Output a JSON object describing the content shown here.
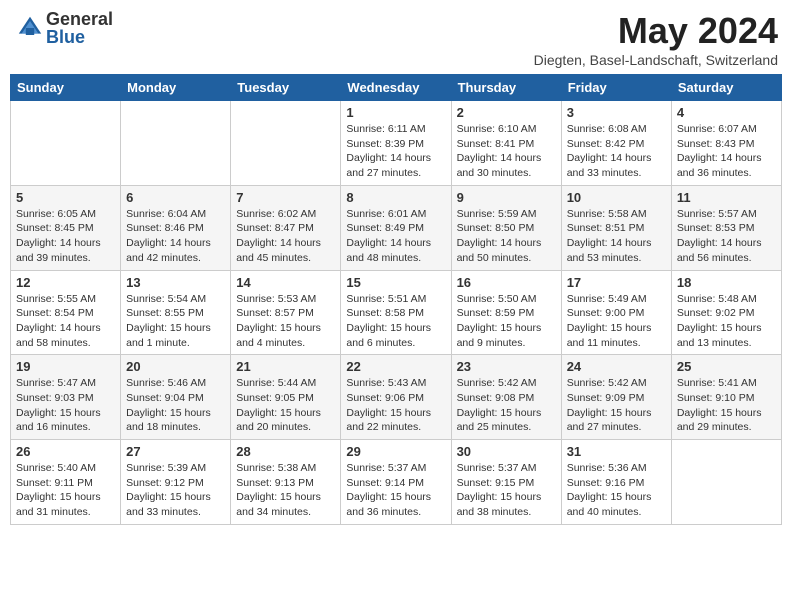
{
  "header": {
    "logo_general": "General",
    "logo_blue": "Blue",
    "month_year": "May 2024",
    "location": "Diegten, Basel-Landschaft, Switzerland"
  },
  "weekdays": [
    "Sunday",
    "Monday",
    "Tuesday",
    "Wednesday",
    "Thursday",
    "Friday",
    "Saturday"
  ],
  "weeks": [
    [
      {
        "day": "",
        "info": ""
      },
      {
        "day": "",
        "info": ""
      },
      {
        "day": "",
        "info": ""
      },
      {
        "day": "1",
        "info": "Sunrise: 6:11 AM\nSunset: 8:39 PM\nDaylight: 14 hours\nand 27 minutes."
      },
      {
        "day": "2",
        "info": "Sunrise: 6:10 AM\nSunset: 8:41 PM\nDaylight: 14 hours\nand 30 minutes."
      },
      {
        "day": "3",
        "info": "Sunrise: 6:08 AM\nSunset: 8:42 PM\nDaylight: 14 hours\nand 33 minutes."
      },
      {
        "day": "4",
        "info": "Sunrise: 6:07 AM\nSunset: 8:43 PM\nDaylight: 14 hours\nand 36 minutes."
      }
    ],
    [
      {
        "day": "5",
        "info": "Sunrise: 6:05 AM\nSunset: 8:45 PM\nDaylight: 14 hours\nand 39 minutes."
      },
      {
        "day": "6",
        "info": "Sunrise: 6:04 AM\nSunset: 8:46 PM\nDaylight: 14 hours\nand 42 minutes."
      },
      {
        "day": "7",
        "info": "Sunrise: 6:02 AM\nSunset: 8:47 PM\nDaylight: 14 hours\nand 45 minutes."
      },
      {
        "day": "8",
        "info": "Sunrise: 6:01 AM\nSunset: 8:49 PM\nDaylight: 14 hours\nand 48 minutes."
      },
      {
        "day": "9",
        "info": "Sunrise: 5:59 AM\nSunset: 8:50 PM\nDaylight: 14 hours\nand 50 minutes."
      },
      {
        "day": "10",
        "info": "Sunrise: 5:58 AM\nSunset: 8:51 PM\nDaylight: 14 hours\nand 53 minutes."
      },
      {
        "day": "11",
        "info": "Sunrise: 5:57 AM\nSunset: 8:53 PM\nDaylight: 14 hours\nand 56 minutes."
      }
    ],
    [
      {
        "day": "12",
        "info": "Sunrise: 5:55 AM\nSunset: 8:54 PM\nDaylight: 14 hours\nand 58 minutes."
      },
      {
        "day": "13",
        "info": "Sunrise: 5:54 AM\nSunset: 8:55 PM\nDaylight: 15 hours\nand 1 minute."
      },
      {
        "day": "14",
        "info": "Sunrise: 5:53 AM\nSunset: 8:57 PM\nDaylight: 15 hours\nand 4 minutes."
      },
      {
        "day": "15",
        "info": "Sunrise: 5:51 AM\nSunset: 8:58 PM\nDaylight: 15 hours\nand 6 minutes."
      },
      {
        "day": "16",
        "info": "Sunrise: 5:50 AM\nSunset: 8:59 PM\nDaylight: 15 hours\nand 9 minutes."
      },
      {
        "day": "17",
        "info": "Sunrise: 5:49 AM\nSunset: 9:00 PM\nDaylight: 15 hours\nand 11 minutes."
      },
      {
        "day": "18",
        "info": "Sunrise: 5:48 AM\nSunset: 9:02 PM\nDaylight: 15 hours\nand 13 minutes."
      }
    ],
    [
      {
        "day": "19",
        "info": "Sunrise: 5:47 AM\nSunset: 9:03 PM\nDaylight: 15 hours\nand 16 minutes."
      },
      {
        "day": "20",
        "info": "Sunrise: 5:46 AM\nSunset: 9:04 PM\nDaylight: 15 hours\nand 18 minutes."
      },
      {
        "day": "21",
        "info": "Sunrise: 5:44 AM\nSunset: 9:05 PM\nDaylight: 15 hours\nand 20 minutes."
      },
      {
        "day": "22",
        "info": "Sunrise: 5:43 AM\nSunset: 9:06 PM\nDaylight: 15 hours\nand 22 minutes."
      },
      {
        "day": "23",
        "info": "Sunrise: 5:42 AM\nSunset: 9:08 PM\nDaylight: 15 hours\nand 25 minutes."
      },
      {
        "day": "24",
        "info": "Sunrise: 5:42 AM\nSunset: 9:09 PM\nDaylight: 15 hours\nand 27 minutes."
      },
      {
        "day": "25",
        "info": "Sunrise: 5:41 AM\nSunset: 9:10 PM\nDaylight: 15 hours\nand 29 minutes."
      }
    ],
    [
      {
        "day": "26",
        "info": "Sunrise: 5:40 AM\nSunset: 9:11 PM\nDaylight: 15 hours\nand 31 minutes."
      },
      {
        "day": "27",
        "info": "Sunrise: 5:39 AM\nSunset: 9:12 PM\nDaylight: 15 hours\nand 33 minutes."
      },
      {
        "day": "28",
        "info": "Sunrise: 5:38 AM\nSunset: 9:13 PM\nDaylight: 15 hours\nand 34 minutes."
      },
      {
        "day": "29",
        "info": "Sunrise: 5:37 AM\nSunset: 9:14 PM\nDaylight: 15 hours\nand 36 minutes."
      },
      {
        "day": "30",
        "info": "Sunrise: 5:37 AM\nSunset: 9:15 PM\nDaylight: 15 hours\nand 38 minutes."
      },
      {
        "day": "31",
        "info": "Sunrise: 5:36 AM\nSunset: 9:16 PM\nDaylight: 15 hours\nand 40 minutes."
      },
      {
        "day": "",
        "info": ""
      }
    ]
  ]
}
